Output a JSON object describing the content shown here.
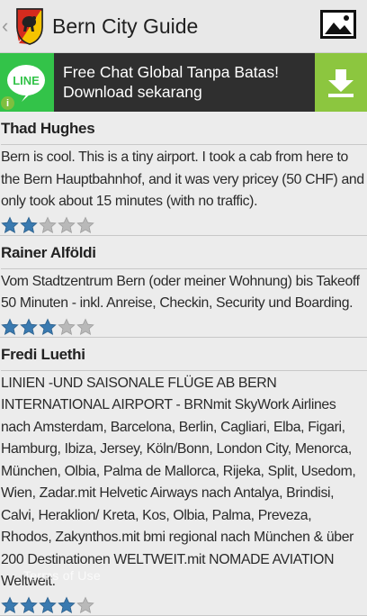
{
  "app": {
    "title": "Bern City Guide",
    "back_glyph": "‹"
  },
  "colors": {
    "star_filled": "#3a7ab0",
    "star_empty": "#b9b9b9",
    "line_green": "#33c349",
    "download_green": "#8cc63f",
    "crest_red": "#d52b1e",
    "crest_yellow": "#f5c400"
  },
  "ad": {
    "logo_text": "LINE",
    "line1": "Free Chat Global Tanpa Batas!",
    "line2": "Download sekarang",
    "info_glyph": "i"
  },
  "reviews": [
    {
      "name": "Thad Hughes",
      "text": "Bern is cool.  This is a tiny airport.  I took a cab from here to the Bern Hauptbahnhof, and it was very pricey (50 CHF) and only took about 15 minutes (with no traffic).",
      "rating": 2
    },
    {
      "name": "Rainer Alföldi",
      "text": "Vom Stadtzentrum Bern (oder meiner Wohnung) bis Takeoff 50 Minuten - inkl. Anreise, Checkin, Security und Boarding.",
      "rating": 3
    },
    {
      "name": "Fredi Luethi",
      "text": "LINIEN -UND SAISONALE  FLÜGE AB BERN INTERNATIONAL AIRPORT - BRNmit SkyWork Airlines nach Amsterdam, Barcelona, Berlin, Cagliari, Elba, Figari, Hamburg, Ibiza, Jersey, Köln/Bonn, London City, Menorca, München, Olbia, Palma de Mallorca, Rijeka, Split, Usedom, Wien, Zadar.mit Helvetic Airways nach Antalya, Brindisi, Calvi, Heraklion/ Kreta, Kos, Olbia, Palma, Preveza, Rhodos, Zakynthos.mit bmi regional nach München & über 200 Destinationen WELTWEIT.mit NOMADE AVIATION Weltweit.",
      "rating": 4
    }
  ],
  "watermark": "Terms of Use"
}
